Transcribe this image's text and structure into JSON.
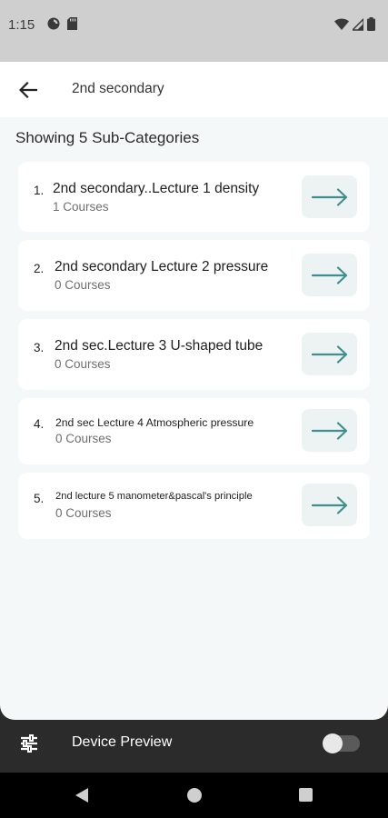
{
  "status": {
    "time": "1:15",
    "icons_left": [
      "data-saver-icon",
      "sd-card-icon"
    ],
    "icons_right": [
      "wifi-icon",
      "signal-icon",
      "battery-icon"
    ]
  },
  "appbar": {
    "title": "2nd secondary",
    "back_icon": "arrow-back-icon"
  },
  "heading": "Showing 5 Sub-Categories",
  "items": [
    {
      "number": "1.",
      "title": "2nd secondary..Lecture 1 density",
      "count": "1 Courses"
    },
    {
      "number": "2.",
      "title": "2nd secondary Lecture 2 pressure",
      "count": "0 Courses"
    },
    {
      "number": "3.",
      "title": "2nd sec.Lecture 3 U-shaped tube",
      "count": "0 Courses"
    },
    {
      "number": "4.",
      "title": "2nd sec Lecture 4 Atmospheric pressure",
      "count": "0 Courses"
    },
    {
      "number": "5.",
      "title": "2nd lecture 5 manometer&pascal's principle",
      "count": "0 Courses"
    }
  ],
  "preview_bar": {
    "label": "Device Preview",
    "toggle_on": false
  },
  "colors": {
    "accent": "#3f8f8f",
    "arrow_button_bg": "#edf3f3",
    "page_bg": "#f5f8f8"
  }
}
